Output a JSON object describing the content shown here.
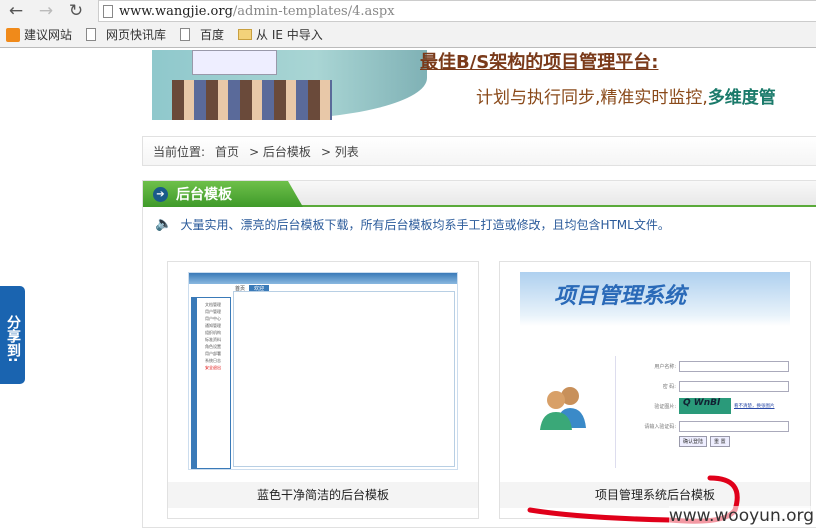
{
  "browser": {
    "url_host": "www.wangjie.org",
    "url_path": "/admin-templates/4.aspx",
    "bookmarks": [
      {
        "label": "建议网站",
        "icon": "suggested-sites-icon"
      },
      {
        "label": "网页快讯库",
        "icon": "page-icon"
      },
      {
        "label": "百度",
        "icon": "page-icon"
      },
      {
        "label": "从 IE 中导入",
        "icon": "folder-icon"
      }
    ]
  },
  "banner": {
    "title": "最佳B/S架构的项目管理平台:",
    "subtitle_plain": "计划与执行同步,精准实时监控,",
    "subtitle_highlight": "多维度管"
  },
  "breadcrumb": {
    "prefix": "当前位置:",
    "items": [
      "首页",
      "> 后台模板",
      "> 列表"
    ]
  },
  "section": {
    "title": "后台模板",
    "notice": "大量实用、漂亮的后台模板下载，所有后台模板均系手工打造或修改，且均包含HTML文件。"
  },
  "cards": [
    {
      "caption": "蓝色干净简洁的后台模板",
      "thumb": {
        "tabs": [
          "首页",
          "欢迎"
        ],
        "menu": [
          "文档管理",
          "用户管理",
          "用户中心",
          "通知管理",
          "组织机构",
          "标准资料",
          "角色设置",
          "用户部署",
          "系统日志",
          "安全退出"
        ]
      }
    },
    {
      "caption": "项目管理系统后台模板",
      "thumb": {
        "title": "项目管理系统",
        "fields": [
          "用户名称:",
          "密  码:",
          "验证图片:",
          "请输入验证码:"
        ],
        "captcha": "Q WnBl",
        "refresh_link": "看不清楚，换张图片",
        "buttons": [
          "确认登陆",
          "重 置"
        ]
      }
    }
  ],
  "share": {
    "label": "分享到:"
  },
  "watermark": "www.wooyun.org",
  "colors": {
    "section_green": "#4aa934",
    "share_blue": "#1a64b0",
    "annotation_red": "#e0001a"
  }
}
